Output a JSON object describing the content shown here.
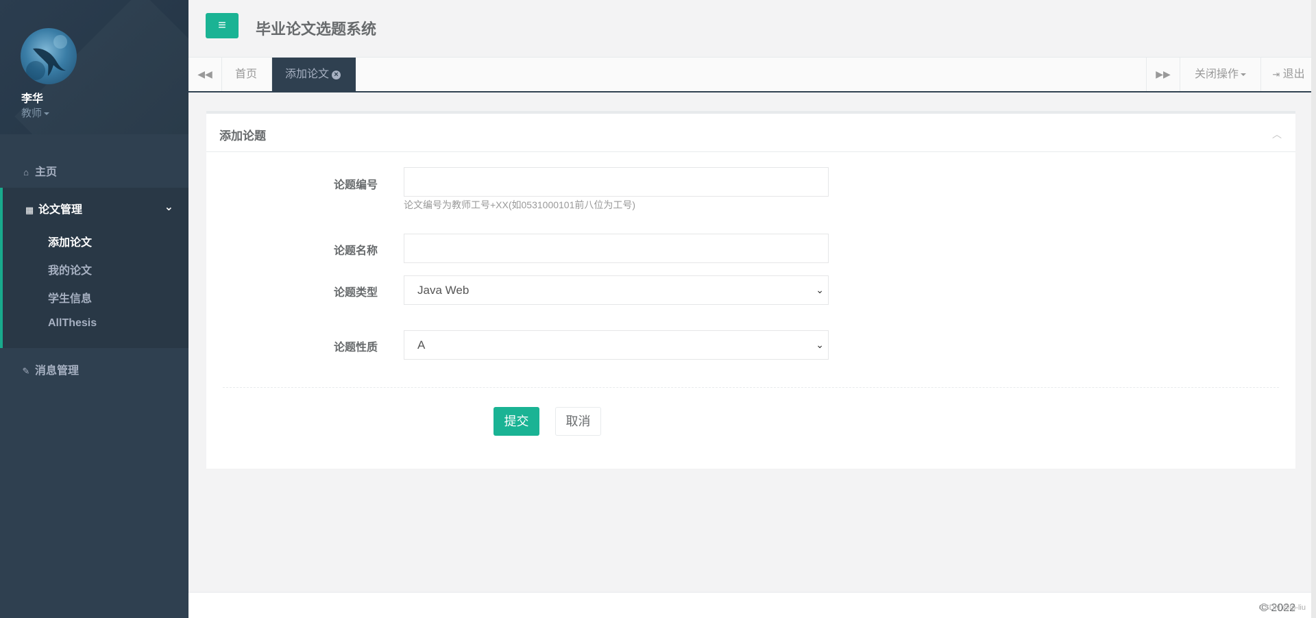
{
  "sidebar": {
    "profile": {
      "name": "李华",
      "role": "教师"
    },
    "home_label": "主页",
    "thesis_group_label": "论文管理",
    "thesis_items": [
      {
        "label": "添加论文",
        "active": true
      },
      {
        "label": "我的论文",
        "active": false
      },
      {
        "label": "学生信息",
        "active": false
      },
      {
        "label": "AllThesis",
        "active": false
      }
    ],
    "message_label": "消息管理"
  },
  "header": {
    "menu_icon": "hamburger-icon",
    "title": "毕业论文选题系统"
  },
  "tabs": {
    "items": [
      {
        "label": "首页",
        "active": false
      },
      {
        "label": "添加论文",
        "active": true
      }
    ],
    "close_ops_label": "关闭操作",
    "logout_label": "退出"
  },
  "form": {
    "title": "添加论题",
    "fields": {
      "code": {
        "label": "论题编号",
        "value": "",
        "help": "论文编号为教师工号+XX(如0531000101前八位为工号)"
      },
      "name": {
        "label": "论题名称",
        "value": ""
      },
      "type": {
        "label": "论题类型",
        "selected": "Java Web"
      },
      "nature": {
        "label": "论题性质",
        "selected": "A"
      }
    },
    "submit_label": "提交",
    "cancel_label": "取消"
  },
  "footer": {
    "copyright": "© 2022",
    "watermark": "CSDN @lp-liu"
  },
  "colors": {
    "accent": "#1ab394",
    "sidebar_bg": "#2f4050",
    "sidebar_active_bg": "#293846"
  }
}
